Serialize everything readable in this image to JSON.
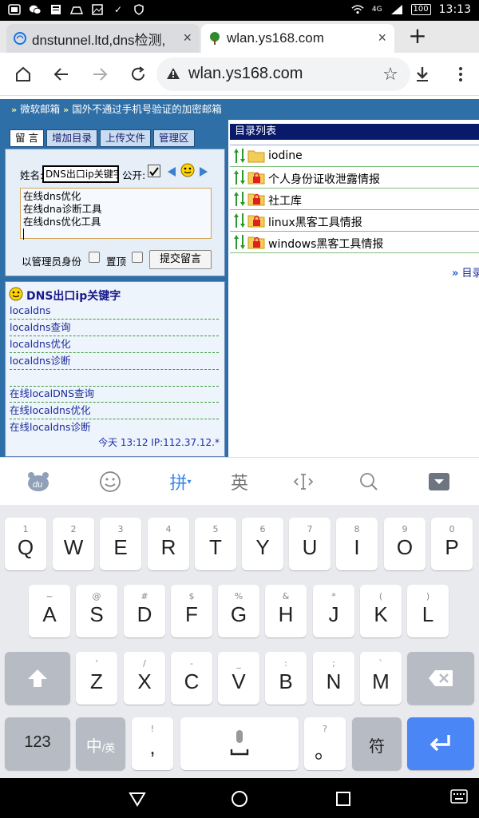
{
  "status": {
    "time": "13:13",
    "battery": "100",
    "network": "4G"
  },
  "tabs": [
    {
      "title": "dnstunnel.ltd,dns检测,",
      "close": "×"
    },
    {
      "title": "wlan.ys168.com",
      "close": "×"
    }
  ],
  "newtab": "+",
  "address": {
    "url": "wlan.ys168.com"
  },
  "page": {
    "topband": {
      "link1": "微软邮箱",
      "link2": "国外不通过手机号验证的加密邮箱",
      "arrows": "»"
    },
    "left_tabs": [
      "留 言",
      "增加目录",
      "上传文件",
      "管理区"
    ],
    "form": {
      "name_label": "姓名:",
      "name_value": "DNS出口ip关键字",
      "public_label": "公开:",
      "message_lines": [
        "在线dns优化",
        "在线dna诊断工具",
        "在线dns优化工具"
      ],
      "admin_label": "以管理员身份",
      "top_label": "置顶",
      "submit": "提交留言"
    },
    "keywords": {
      "title": "DNS出口ip关键字",
      "items": [
        "localdns",
        "localdns查询",
        "localdns优化",
        "localdns诊断",
        "",
        "在线localDNS查询",
        "在线localdns优化",
        "在线localdns诊断"
      ],
      "footer": "今天 13:12 IP:112.37.12.*"
    },
    "directory": {
      "header": "目录列表",
      "items": [
        {
          "name": "iodine",
          "locked": false
        },
        {
          "name": "个人身份证收泄露情报",
          "locked": true
        },
        {
          "name": "社工库",
          "locked": true
        },
        {
          "name": "linux黑客工具情报",
          "locked": true
        },
        {
          "name": "windows黑客工具情报",
          "locked": true
        }
      ],
      "more": "目录"
    }
  },
  "ime": {
    "pinyin": "拼",
    "english": "英"
  },
  "keyboard": {
    "row1": [
      {
        "sub": "1",
        "key": "Q"
      },
      {
        "sub": "2",
        "key": "W"
      },
      {
        "sub": "3",
        "key": "E"
      },
      {
        "sub": "4",
        "key": "R"
      },
      {
        "sub": "5",
        "key": "T"
      },
      {
        "sub": "6",
        "key": "Y"
      },
      {
        "sub": "7",
        "key": "U"
      },
      {
        "sub": "8",
        "key": "I"
      },
      {
        "sub": "9",
        "key": "O"
      },
      {
        "sub": "0",
        "key": "P"
      }
    ],
    "row2": [
      {
        "sub": "~",
        "key": "A"
      },
      {
        "sub": "@",
        "key": "S"
      },
      {
        "sub": "#",
        "key": "D"
      },
      {
        "sub": "$",
        "key": "F"
      },
      {
        "sub": "%",
        "key": "G"
      },
      {
        "sub": "&",
        "key": "H"
      },
      {
        "sub": "*",
        "key": "J"
      },
      {
        "sub": "(",
        "key": "K"
      },
      {
        "sub": ")",
        "key": "L"
      }
    ],
    "row3": [
      {
        "sub": "'",
        "key": "Z"
      },
      {
        "sub": "/",
        "key": "X"
      },
      {
        "sub": "-",
        "key": "C"
      },
      {
        "sub": "_",
        "key": "V"
      },
      {
        "sub": ":",
        "key": "B"
      },
      {
        "sub": ";",
        "key": "N"
      },
      {
        "sub": "`",
        "key": "M"
      }
    ],
    "num": "123",
    "zh": "中",
    "zh_sub": "/英",
    "comma_sub": "!",
    "comma": ",",
    "period_sub": "?",
    "period": "。",
    "symbols": "符"
  },
  "colors": {
    "accent": "#2f6fa7",
    "dir_header": "#0a1a6a",
    "enter_key": "#4a86f6"
  }
}
